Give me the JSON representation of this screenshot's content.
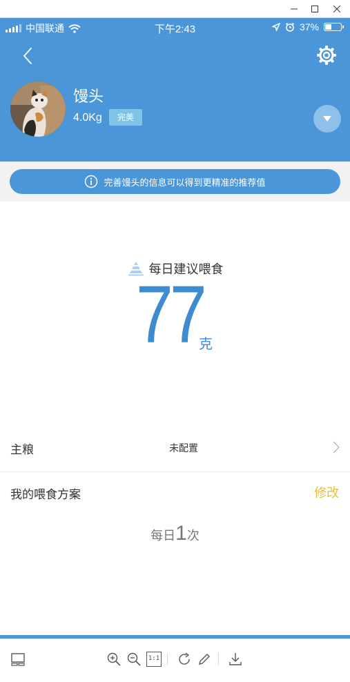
{
  "window": {
    "controls": [
      "minimize",
      "maximize",
      "close"
    ]
  },
  "status_bar": {
    "carrier": "中国联通",
    "time": "下午2:43",
    "battery": "37%",
    "battery_level": 0.37
  },
  "pet": {
    "name": "馒头",
    "weight": "4.0Kg",
    "status_badge": "完美"
  },
  "info_banner": {
    "text": "完善馒头的信息可以得到更精准的推荐值"
  },
  "daily_feed": {
    "title": "每日建议喂食",
    "value": "77",
    "unit": "克"
  },
  "main_food": {
    "label": "主粮",
    "value": "未配置"
  },
  "plan": {
    "label": "我的喂食方案",
    "edit_label": "修改",
    "freq_prefix": "每日",
    "freq_num": "1",
    "freq_suffix": "次"
  },
  "colors": {
    "brand_blue": "#4a96d9",
    "accent_yellow": "#e3c23f"
  },
  "toolbar": {
    "icons": [
      "layout-icon",
      "zoom-in-icon",
      "zoom-out-icon",
      "actual-size-icon",
      "rotate-icon",
      "edit-icon",
      "download-icon"
    ],
    "actual_size_label": "1:1"
  }
}
